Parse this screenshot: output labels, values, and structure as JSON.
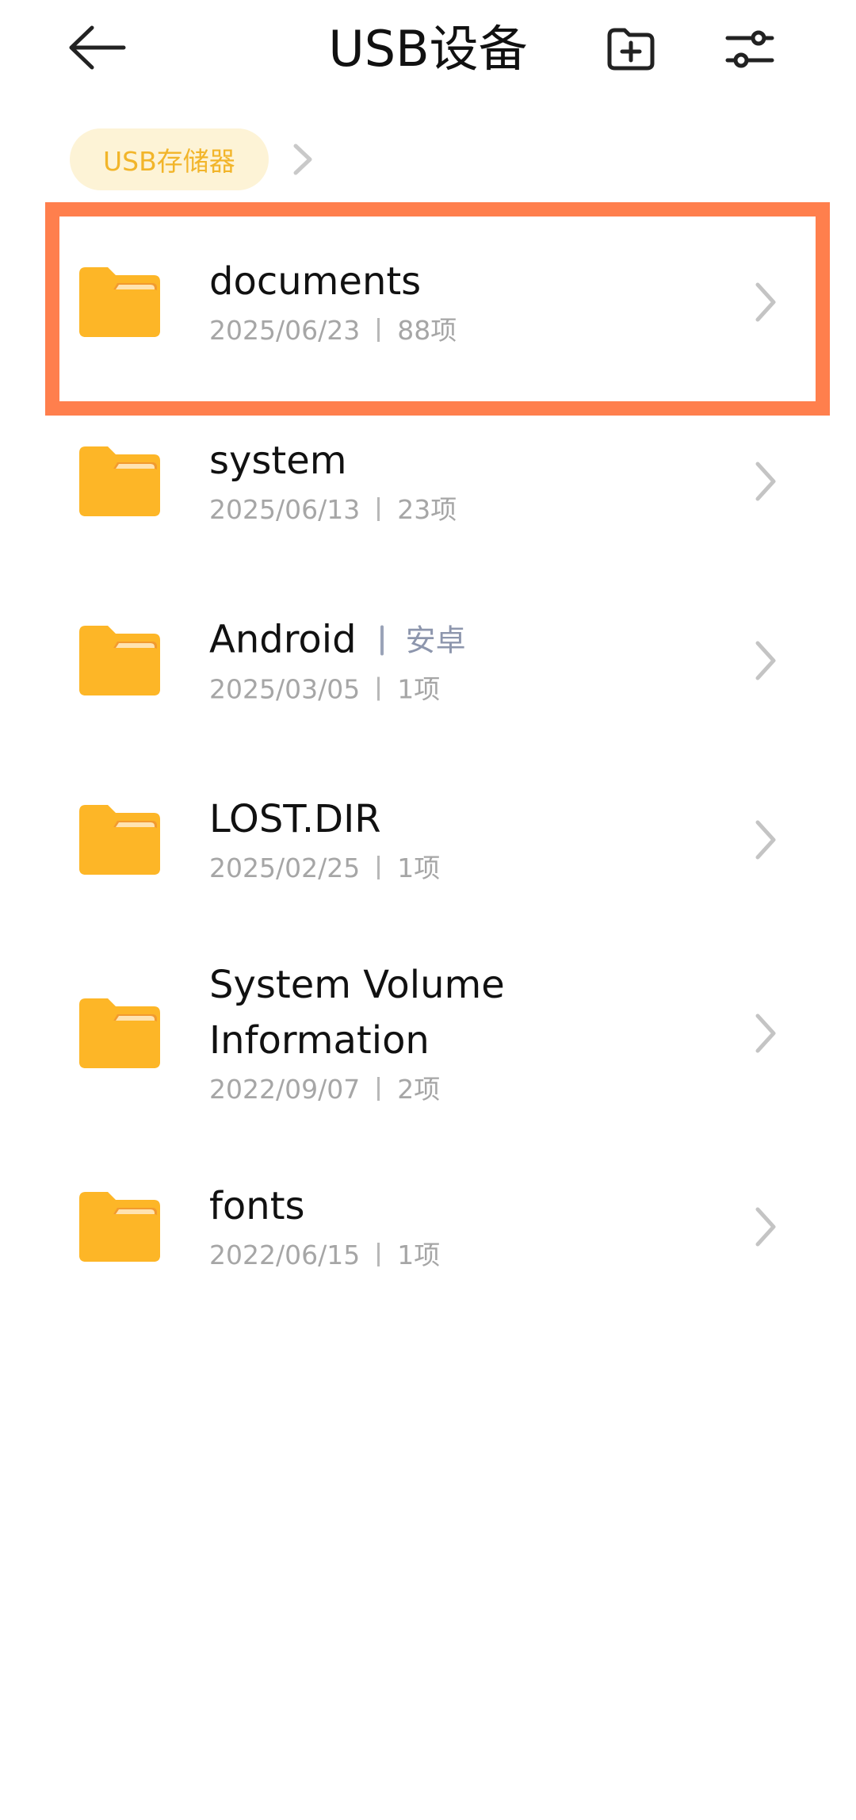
{
  "header": {
    "title": "USB设备",
    "back_icon": "arrow-left-icon",
    "new_folder_icon": "folder-plus-icon",
    "settings_icon": "sliders-icon"
  },
  "breadcrumb": {
    "items": [
      {
        "label": "USB存储器"
      }
    ]
  },
  "colors": {
    "folder": "#FDB627",
    "folder_tab": "#F29A2E",
    "highlight": "#FF7F4D",
    "chip_bg": "#FDF3D6",
    "chip_text": "#F2B52A"
  },
  "folders": [
    {
      "name": "documents",
      "alias": "",
      "date": "2025/06/23",
      "count": "88项"
    },
    {
      "name": "system",
      "alias": "",
      "date": "2025/06/13",
      "count": "23项"
    },
    {
      "name": "Android",
      "alias": "安卓",
      "date": "2025/03/05",
      "count": "1项"
    },
    {
      "name": "LOST.DIR",
      "alias": "",
      "date": "2025/02/25",
      "count": "1项"
    },
    {
      "name": "System Volume Information",
      "alias": "",
      "date": "2022/09/07",
      "count": "2项"
    },
    {
      "name": "fonts",
      "alias": "",
      "date": "2022/06/15",
      "count": "1项"
    }
  ]
}
